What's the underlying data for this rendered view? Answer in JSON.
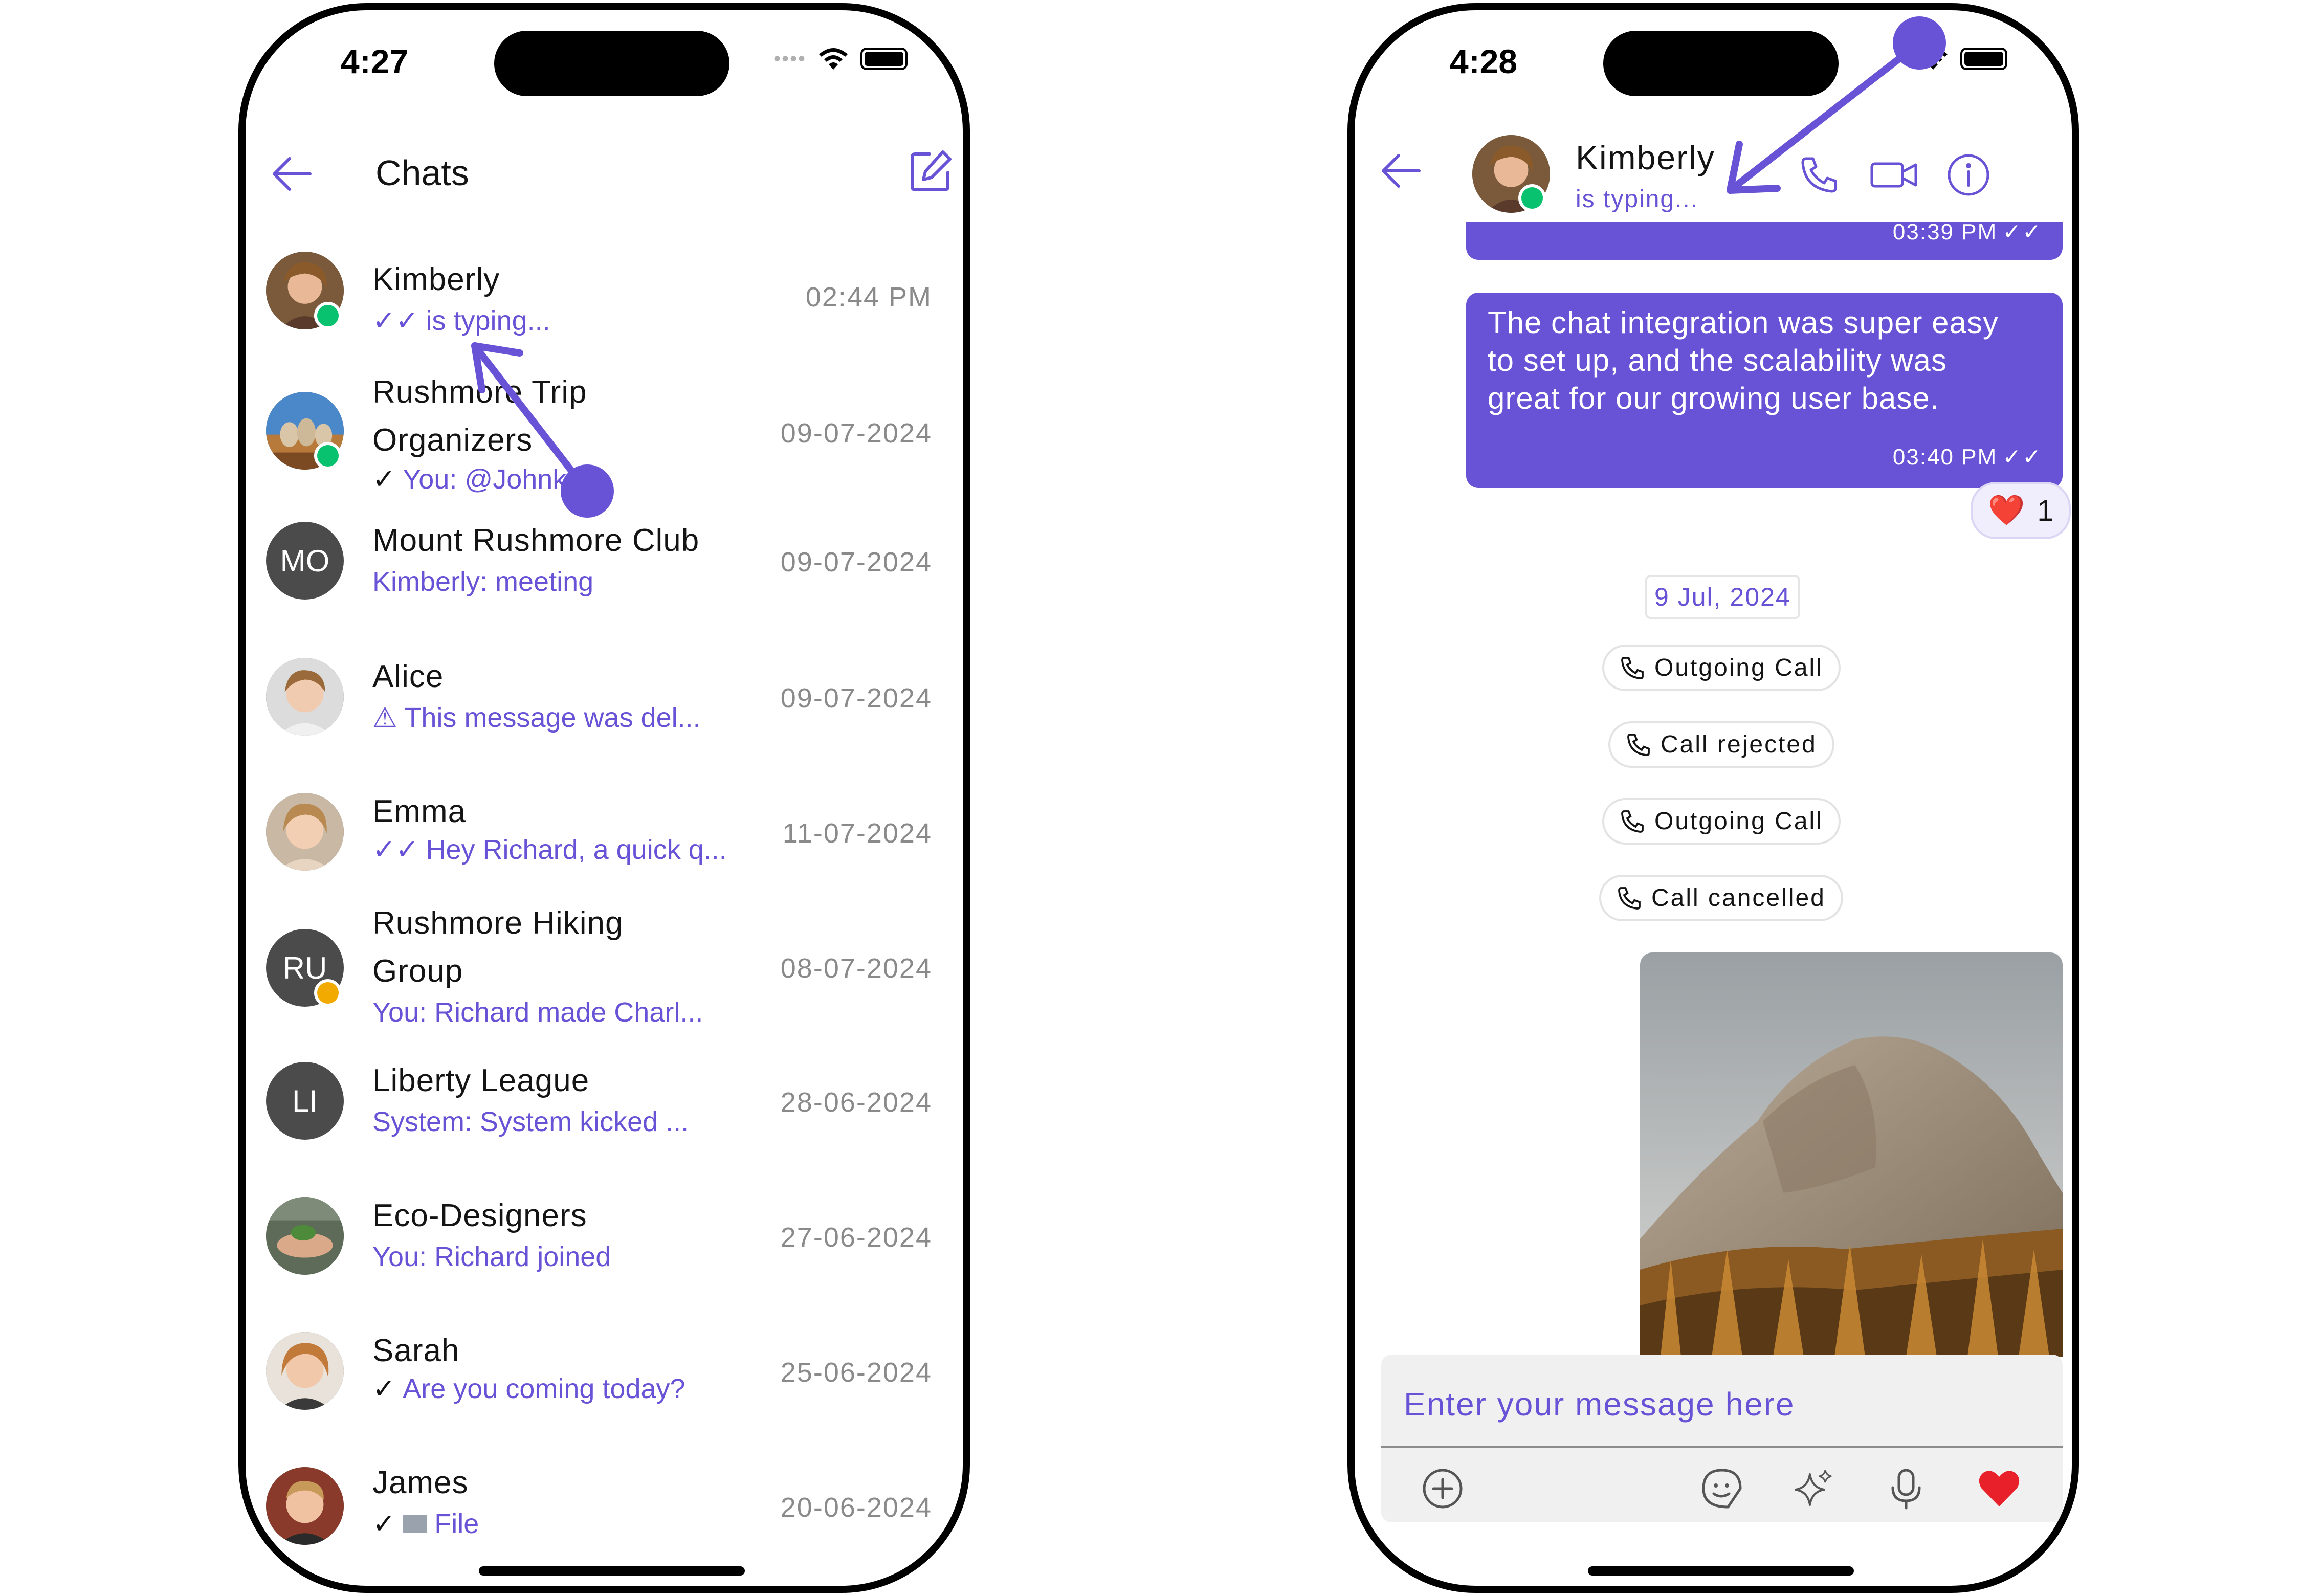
{
  "left_screen": {
    "status_bar": {
      "time": "4:27"
    },
    "header": {
      "title": "Chats",
      "back_icon": "arrow-left-icon",
      "compose_icon": "compose-icon"
    },
    "chats": [
      {
        "name": "Kimberly",
        "subtitle": "is typing...",
        "time": "02:44 PM",
        "avatar_type": "photo",
        "receipt": "read",
        "badge": "online"
      },
      {
        "name_line1": "Rushmore Trip",
        "name_line2": "Organizers",
        "subtitle": "You: @Johnk",
        "time": "09-07-2024",
        "avatar_type": "photo",
        "receipt": "sent",
        "badge": "green"
      },
      {
        "name": "Mount Rushmore Club",
        "initials": "MO",
        "subtitle": "Kimberly: meeting",
        "time": "09-07-2024"
      },
      {
        "name": "Alice",
        "subtitle": "This message was del...",
        "time": "09-07-2024",
        "avatar_type": "photo",
        "subtitle_icon": "warning-icon"
      },
      {
        "name": "Emma",
        "subtitle": "Hey Richard, a quick q...",
        "time": "11-07-2024",
        "avatar_type": "photo",
        "receipt": "read"
      },
      {
        "name_line1": "Rushmore Hiking",
        "name_line2": "Group",
        "initials": "RU",
        "subtitle": "You: Richard made Charl...",
        "time": "08-07-2024",
        "badge": "lock"
      },
      {
        "name": "Liberty League",
        "initials": "LI",
        "subtitle": "System: System kicked ...",
        "time": "28-06-2024"
      },
      {
        "name": "Eco-Designers",
        "subtitle": "You: Richard joined",
        "time": "27-06-2024",
        "avatar_type": "photo"
      },
      {
        "name": "Sarah",
        "subtitle": "Are you coming today?",
        "time": "25-06-2024",
        "avatar_type": "photo",
        "receipt": "sent"
      },
      {
        "name": "James",
        "subtitle": "File",
        "time": "20-06-2024",
        "avatar_type": "photo",
        "receipt": "sent",
        "subtitle_icon": "folder-icon"
      }
    ]
  },
  "right_screen": {
    "status_bar": {
      "time": "4:28"
    },
    "header": {
      "contact_name": "Kimberly",
      "contact_status": "is typing...",
      "icons": [
        "arrow-left-icon",
        "phone-icon",
        "video-icon",
        "info-icon"
      ]
    },
    "messages": [
      {
        "time": "03:39 PM"
      },
      {
        "text_lines": [
          "The chat integration was super easy",
          "to set up, and the scalability was",
          "great for our growing user base."
        ],
        "time": "03:40 PM"
      }
    ],
    "reaction": {
      "emoji": "❤️",
      "count": "1"
    },
    "date_separator": "9 Jul, 2024",
    "calls": [
      "Outgoing Call",
      "Call rejected",
      "Outgoing Call",
      "Call cancelled"
    ],
    "composer": {
      "placeholder": "Enter your message here",
      "icons": [
        "add-icon",
        "sticker-icon",
        "ai-sparkle-icon",
        "microphone-icon",
        "heart-icon"
      ]
    }
  },
  "colors": {
    "accent": "#6852d6",
    "online": "#09c26f",
    "lock": "#f2a900"
  }
}
